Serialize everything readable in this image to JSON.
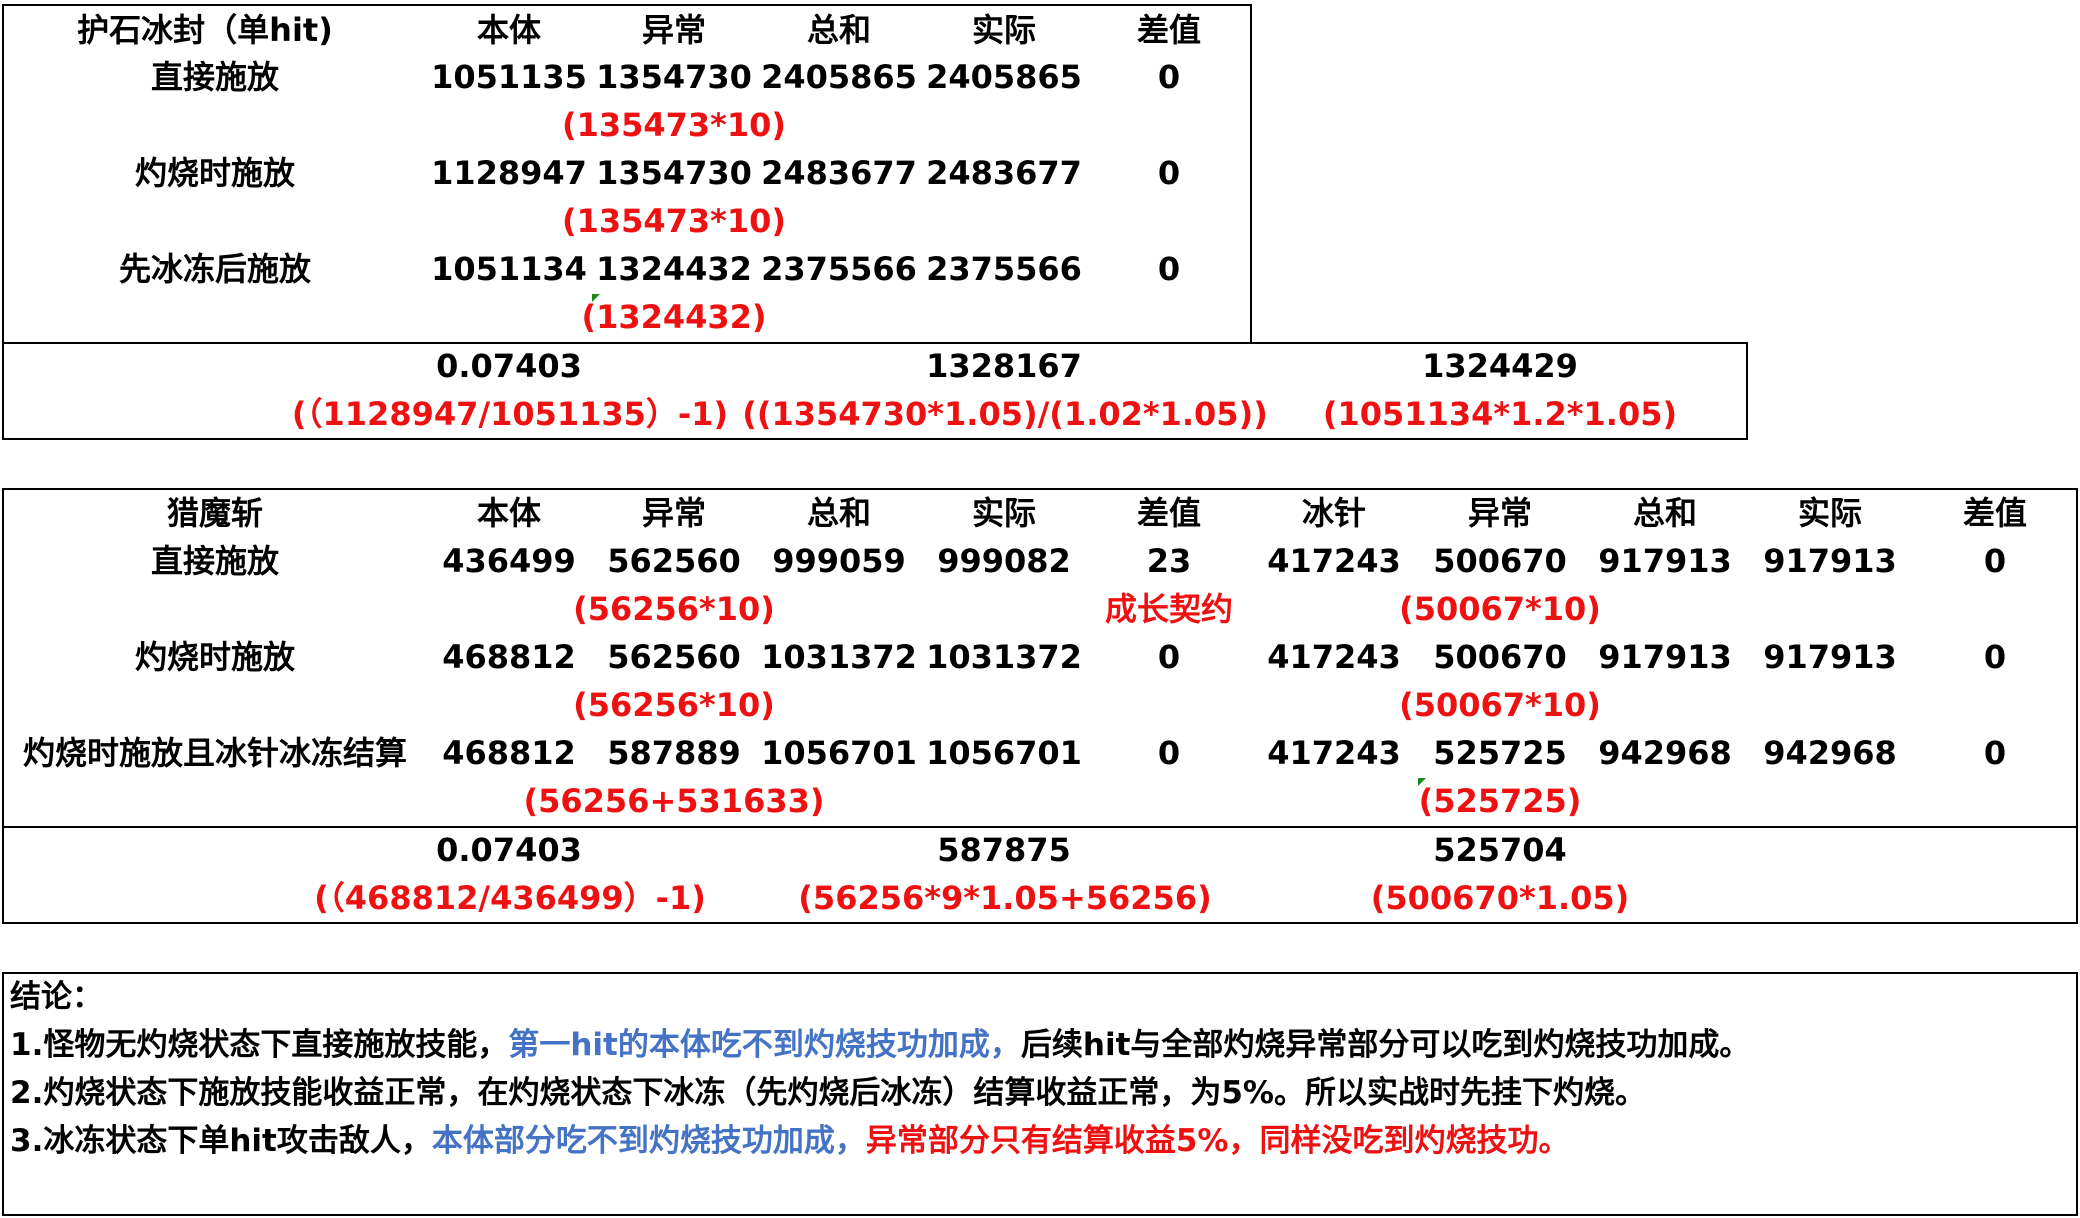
{
  "table1": {
    "title": "护石冰封（单hit)",
    "headers": [
      "本体",
      "异常",
      "总和",
      "实际",
      "差值"
    ],
    "rows": [
      {
        "label": "直接施放",
        "values": [
          "1051135",
          "1354730",
          "2405865",
          "2405865",
          "0"
        ],
        "note": "(135473*10)"
      },
      {
        "label": "灼烧时施放",
        "values": [
          "1128947",
          "1354730",
          "2483677",
          "2483677",
          "0"
        ],
        "note": "(135473*10)"
      },
      {
        "label": "先冰冻后施放",
        "values": [
          "1051134",
          "1324432",
          "2375566",
          "2375566",
          "0"
        ],
        "note": "(1324432)"
      }
    ]
  },
  "summary1": {
    "values": [
      "0.07403",
      "1328167",
      "1324429"
    ],
    "formulas": [
      "(（1128947/1051135）-1)",
      "((1354730*1.05)/(1.02*1.05))",
      "(1051134*1.2*1.05)"
    ]
  },
  "table2": {
    "title": "猎魔斩",
    "headers": [
      "本体",
      "异常",
      "总和",
      "实际",
      "差值",
      "冰针",
      "异常",
      "总和",
      "实际",
      "差值"
    ],
    "rows": [
      {
        "label": "直接施放",
        "values": [
          "436499",
          "562560",
          "999059",
          "999082",
          "23",
          "417243",
          "500670",
          "917913",
          "917913",
          "0"
        ],
        "note1": "(56256*10)",
        "note_mid": "成长契约",
        "note2": "(50067*10)"
      },
      {
        "label": "灼烧时施放",
        "values": [
          "468812",
          "562560",
          "1031372",
          "1031372",
          "0",
          "417243",
          "500670",
          "917913",
          "917913",
          "0"
        ],
        "note1": "(56256*10)",
        "note2": "(50067*10)"
      },
      {
        "label": "灼烧时施放且冰针冰冻结算",
        "values": [
          "468812",
          "587889",
          "1056701",
          "1056701",
          "0",
          "417243",
          "525725",
          "942968",
          "942968",
          "0"
        ],
        "note1": "(56256+531633)",
        "note2": "(525725)"
      }
    ]
  },
  "summary2": {
    "values": [
      "0.07403",
      "587875",
      "525704"
    ],
    "formulas": [
      "(（468812/436499）-1)",
      "(56256*9*1.05+56256)",
      "(500670*1.05)"
    ]
  },
  "conclusion": {
    "title": "结论：",
    "line1_a": "1.怪物无灼烧状态下直接施放技能，",
    "line1_b": "第一hit的本体吃不到灼烧技功加成，",
    "line1_c": "后续hit与全部灼烧异常部分可以吃到灼烧技功加成。",
    "line2": "2.灼烧状态下施放技能收益正常，在灼烧状态下冰冻（先灼烧后冰冻）结算收益正常，为5%。所以实战时先挂下灼烧。",
    "line3_a": "3.冰冻状态下单hit攻击敌人，",
    "line3_b": "本体部分吃不到灼烧技功加成，",
    "line3_c": "异常部分只有结算收益5%，同样没吃到灼烧技功。"
  },
  "colors": {
    "red": "#ee1111",
    "blue": "#4472c4",
    "marker": "#1a8a1a"
  }
}
